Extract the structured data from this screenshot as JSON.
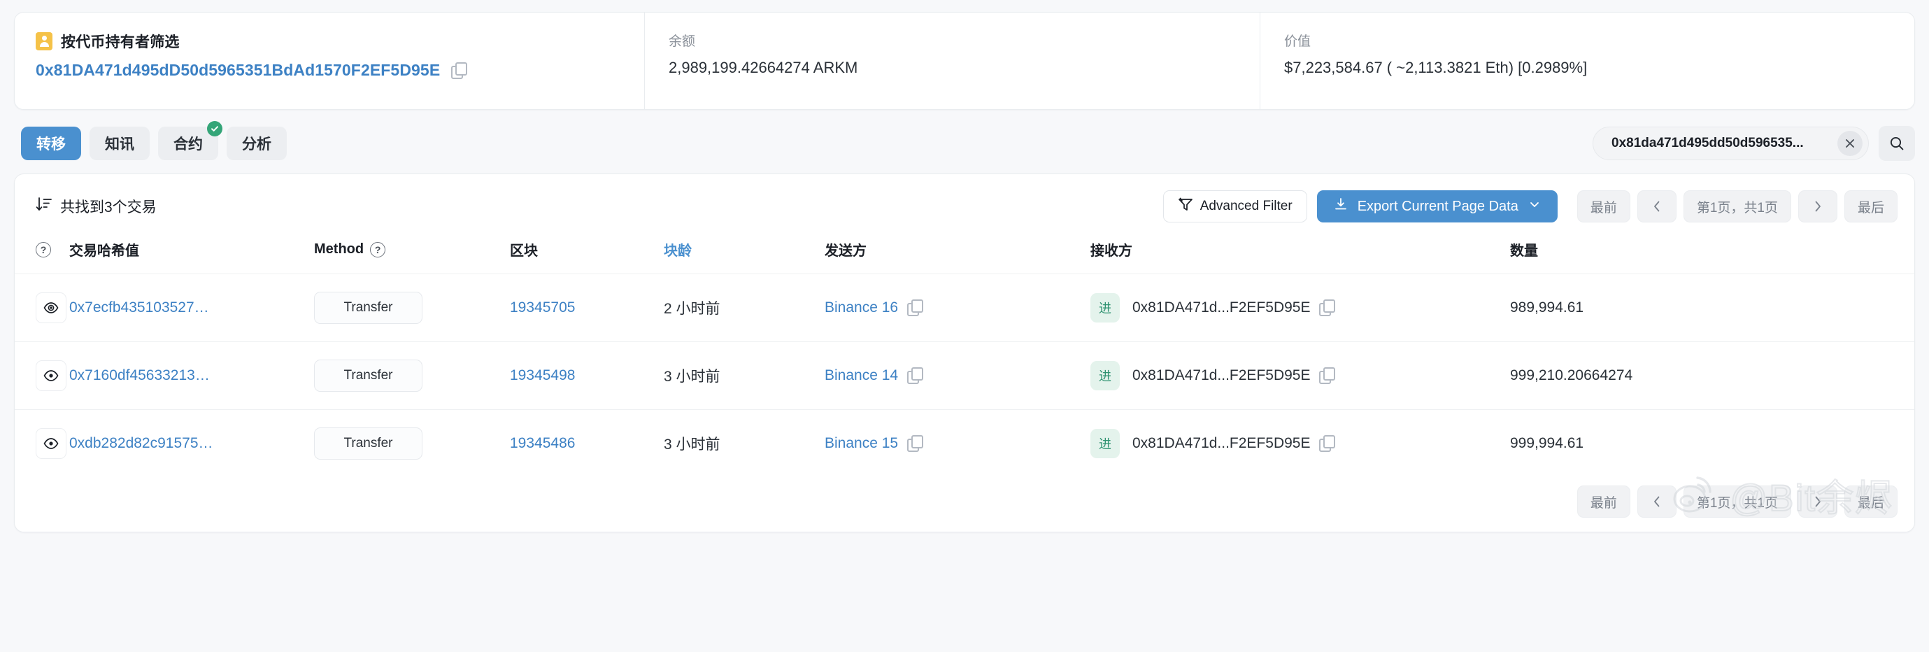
{
  "summary": {
    "filter": {
      "icon": "contact-card-icon",
      "title": "按代币持有者筛选",
      "address": "0x81DA471d495dD50d5965351BdAd1570F2EF5D95E",
      "copy_icon": "copy-icon"
    },
    "balance": {
      "label": "余额",
      "value": "2,989,199.42664274 ARKM"
    },
    "value": {
      "label": "价值",
      "value": "$7,223,584.67 ( ~2,113.3821 Eth) [0.2989%]"
    }
  },
  "tabs": [
    {
      "label": "转移",
      "active": true,
      "badge": false
    },
    {
      "label": "知讯",
      "active": false,
      "badge": false
    },
    {
      "label": "合约",
      "active": false,
      "badge": true
    },
    {
      "label": "分析",
      "active": false,
      "badge": false
    }
  ],
  "search": {
    "value": "0x81da471d495dd50d596535...",
    "placeholder": "",
    "clear_icon": "close-icon",
    "search_icon": "search-icon"
  },
  "toolbar": {
    "sort_icon": "sort-descending-icon",
    "found_text": "共找到3个交易",
    "advanced_filter_label": "Advanced Filter",
    "advanced_filter_icon": "funnel-icon",
    "export_label": "Export Current Page Data",
    "export_icon": "download-icon",
    "export_caret_icon": "chevron-down-icon"
  },
  "pagination": {
    "first": "最前",
    "prev_icon": "chevron-left-icon",
    "page_info": "第1页，共1页",
    "next_icon": "chevron-right-icon",
    "last": "最后"
  },
  "table": {
    "columns": [
      {
        "key": "eye",
        "label": "",
        "help": true,
        "sorted": false
      },
      {
        "key": "hash",
        "label": "交易哈希值",
        "help": false,
        "sorted": false
      },
      {
        "key": "method",
        "label": "Method",
        "help": true,
        "sorted": false
      },
      {
        "key": "block",
        "label": "区块",
        "help": false,
        "sorted": false
      },
      {
        "key": "age",
        "label": "块龄",
        "help": false,
        "sorted": true
      },
      {
        "key": "from",
        "label": "发送方",
        "help": false,
        "sorted": false
      },
      {
        "key": "to",
        "label": "接收方",
        "help": false,
        "sorted": false
      },
      {
        "key": "amount",
        "label": "数量",
        "help": false,
        "sorted": false
      }
    ],
    "rows": [
      {
        "eye_icon": "eye-filled-icon",
        "hash": "0x7ecfb435103527…",
        "method": "Transfer",
        "block": "19345705",
        "age": "2 小时前",
        "from": "Binance 16",
        "direction": "进",
        "to": "0x81DA471d...F2EF5D95E",
        "amount": "989,994.61"
      },
      {
        "eye_icon": "eye-icon",
        "hash": "0x7160df45633213…",
        "method": "Transfer",
        "block": "19345498",
        "age": "3 小时前",
        "from": "Binance 14",
        "direction": "进",
        "to": "0x81DA471d...F2EF5D95E",
        "amount": "999,210.20664274"
      },
      {
        "eye_icon": "eye-icon",
        "hash": "0xdb282d82c91575…",
        "method": "Transfer",
        "block": "19345486",
        "age": "3 小时前",
        "from": "Binance 15",
        "direction": "进",
        "to": "0x81DA471d...F2EF5D95E",
        "amount": "999,994.61"
      }
    ]
  },
  "watermark": {
    "logo_icon": "weibo-icon",
    "text": "@Bit余烬"
  },
  "colors": {
    "accent": "#4a90cf",
    "link": "#3d81c4",
    "badge_green": "#34a578",
    "in_badge_bg": "#e4f3ec",
    "in_badge_fg": "#2e9270",
    "warn_yellow": "#f5c248",
    "page_bg": "#f7f8fa"
  }
}
